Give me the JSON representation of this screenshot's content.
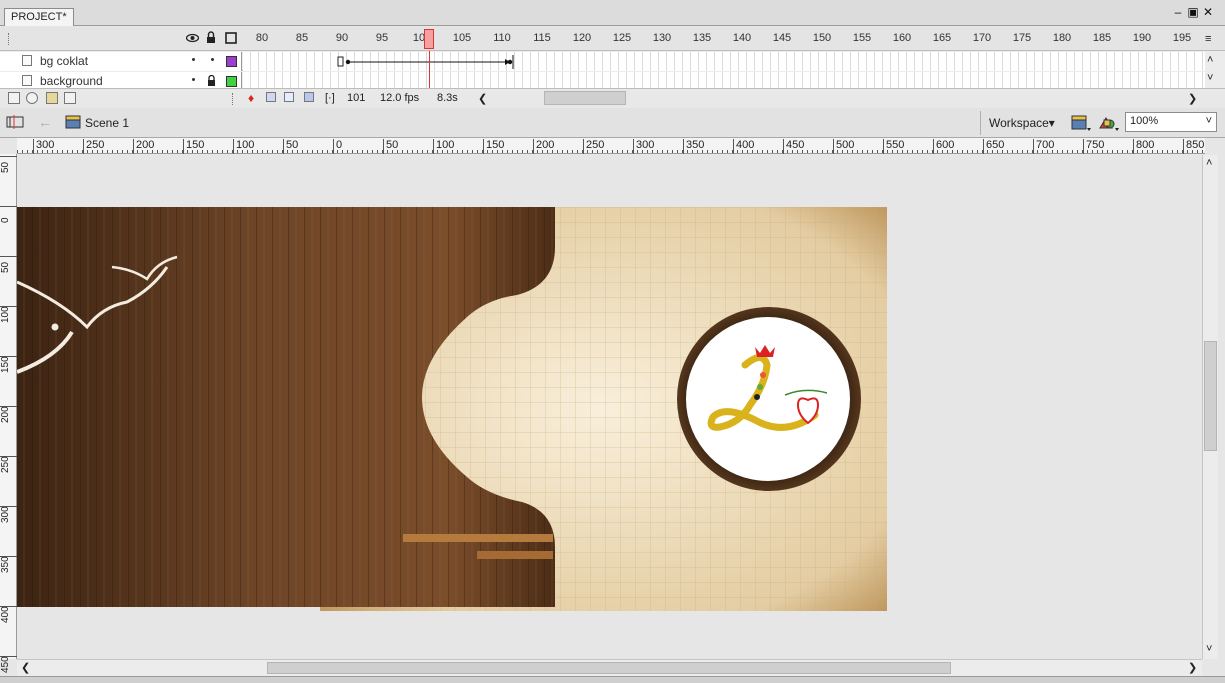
{
  "document": {
    "tab_label": "PROJECT*"
  },
  "window_controls": {
    "minimize": "–",
    "restore": "▣",
    "close": "✕"
  },
  "timeline": {
    "frame_numbers": [
      "80",
      "85",
      "90",
      "95",
      "100",
      "105",
      "110",
      "115",
      "120",
      "125",
      "130",
      "135",
      "140",
      "145",
      "150",
      "155",
      "160",
      "165",
      "170",
      "175",
      "180",
      "185",
      "190",
      "195"
    ],
    "current_frame_marker": "100",
    "layers": [
      {
        "name": "bg coklat",
        "color": "#9b3fd1"
      },
      {
        "name": "background",
        "color": "#3fd13f"
      }
    ],
    "footer": {
      "current_frame": "101",
      "fps": "12.0 fps",
      "elapsed": "8.3s"
    }
  },
  "editbar": {
    "scene": "Scene 1",
    "workspace": "Workspace▾",
    "zoom": "100%"
  },
  "rulers": {
    "horizontal": [
      "300",
      "250",
      "200",
      "150",
      "100",
      "50",
      "0",
      "50",
      "100",
      "150",
      "200",
      "250",
      "300",
      "350",
      "400",
      "450",
      "500",
      "550",
      "600",
      "650",
      "700",
      "750",
      "800",
      "850"
    ],
    "vertical": [
      "50",
      "0",
      "50",
      "100",
      "150",
      "200",
      "250",
      "300",
      "350",
      "400",
      "450"
    ]
  },
  "icons": {
    "eye": "eye-icon",
    "lock": "lock-icon",
    "outline": "outline-icon",
    "back": "back-arrow-icon",
    "scene": "scene-clapper-icon",
    "edit_symbols": "edit-symbols-icon",
    "edit_scene": "edit-scene-icon"
  }
}
